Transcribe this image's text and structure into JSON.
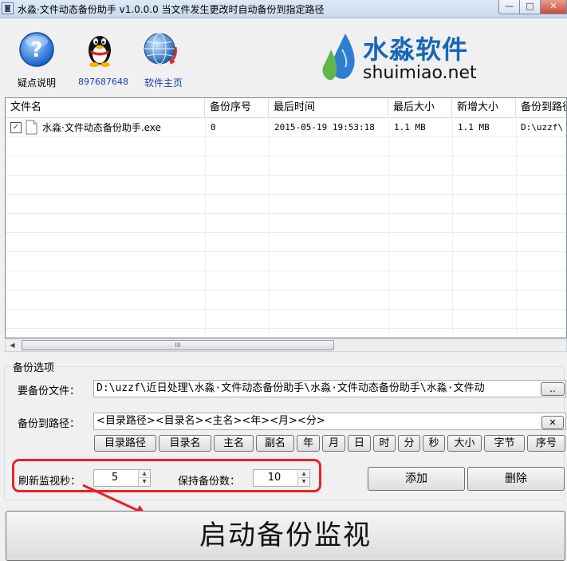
{
  "window": {
    "title": "水淼·文件动态备份助手 v1.0.0.0    当文件发生更改时自动备份到指定路径",
    "minimize_glyph": "—",
    "maximize_glyph": "□",
    "close_glyph": "✕"
  },
  "toolbar": {
    "help_label": "疑点说明",
    "qq_label": "897687648",
    "home_label": "软件主页"
  },
  "brand": {
    "name": "水淼软件",
    "url": "shuimiao.net"
  },
  "table": {
    "columns": [
      "文件名",
      "备份序号",
      "最后时间",
      "最后大小",
      "新增大小",
      "备份到路径"
    ],
    "rows": [
      {
        "checked": true,
        "file": "水淼·文件动态备份助手.exe",
        "seq": "0",
        "last_time": "2015-05-19 19:53:18",
        "last_size": "1.1 MB",
        "added_size": "1.1 MB",
        "dest": "D:\\uzzf\\"
      }
    ]
  },
  "scrollbar": {
    "thumb_grip": "III"
  },
  "options": {
    "group_label": "备份选项",
    "source_label": "要备份文件：",
    "source_value": "D:\\uzzf\\近日处理\\水淼·文件动态备份助手\\水淼·文件动态备份助手\\水淼·文件动",
    "browse_label": "..",
    "dest_label": "备份到路径：",
    "dest_value": "<目录路径><目录名><主名><年><月><分>",
    "clear_label": "✕",
    "tags": [
      "目录路径",
      "目录名",
      "主名",
      "副名",
      "年",
      "月",
      "日",
      "时",
      "分",
      "秒",
      "大小",
      "字节",
      "序号"
    ],
    "refresh_label": "刷新监视秒：",
    "refresh_value": "5",
    "keep_label": "保持备份数：",
    "keep_value": "10",
    "add_label": "添加",
    "delete_label": "删除",
    "start_label": "启动备份监视"
  },
  "colors": {
    "highlight": "#e8222a",
    "brand_blue": "#1766b8",
    "link_blue": "#1a3eb5"
  },
  "icons": [
    "app-icon",
    "help-icon",
    "qq-penguin-icon",
    "globe-icon",
    "water-drops-logo",
    "file-icon",
    "checkbox-icon",
    "scroll-left-arrow-icon",
    "red-annotation-arrow"
  ]
}
